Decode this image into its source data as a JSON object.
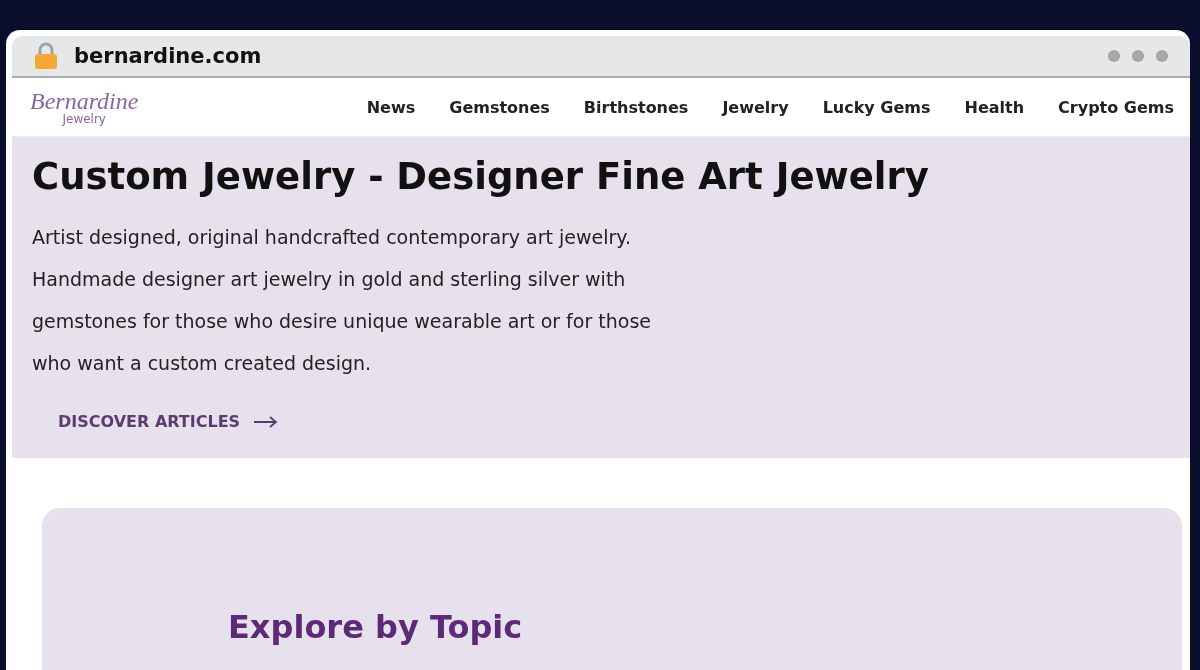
{
  "address_bar": {
    "url": "bernardine.com"
  },
  "logo": {
    "name": "Bernardine",
    "subtitle": "Jewelry"
  },
  "nav": [
    "News",
    "Gemstones",
    "Birthstones",
    "Jewelry",
    "Lucky Gems",
    "Health",
    "Crypto Gems"
  ],
  "hero": {
    "title": "Custom Jewelry - Designer Fine Art Jewelry",
    "text": "Artist designed, original handcrafted contemporary art jewelry. Handmade designer art jewelry in gold and sterling silver with gemstones for those who desire unique wearable art or for those who want a custom created design.",
    "link": "DISCOVER ARTICLES"
  },
  "topics": {
    "title": "Explore by Topic"
  }
}
